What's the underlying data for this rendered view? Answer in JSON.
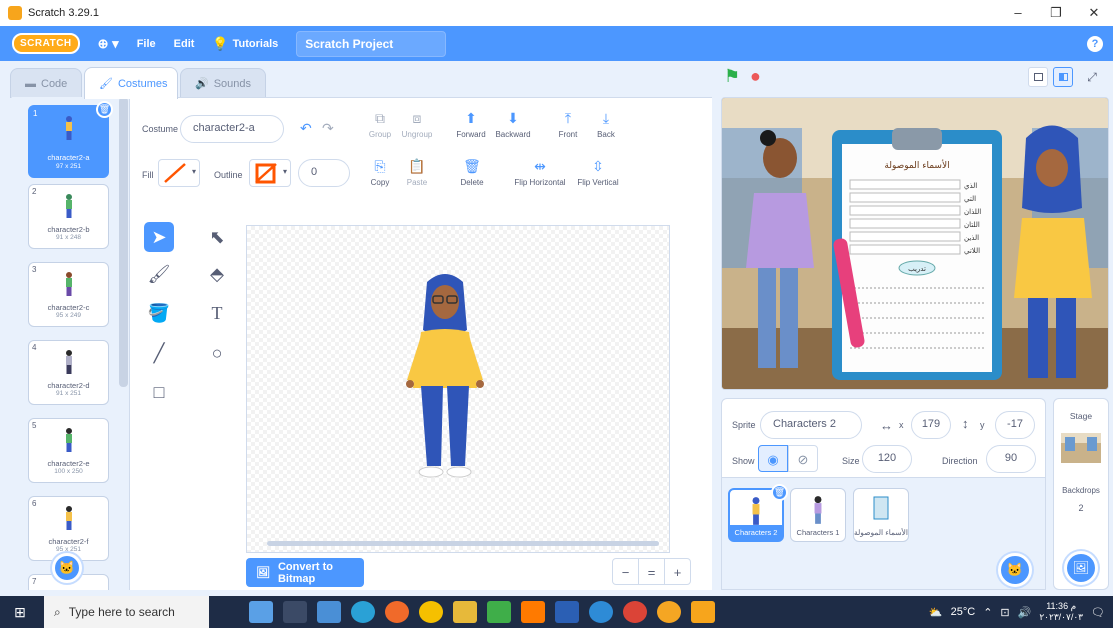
{
  "window": {
    "title": "Scratch 3.29.1",
    "controls": [
      "–",
      "❐",
      "✕"
    ]
  },
  "menubar": {
    "logo": "SCRATCH",
    "globe": "⊕ ▾",
    "file": "File",
    "edit": "Edit",
    "tutorials": "Tutorials",
    "project_title": "Scratch Project",
    "help": "?"
  },
  "tabs": {
    "code": "Code",
    "costumes": "Costumes",
    "sounds": "Sounds"
  },
  "costumes": [
    {
      "num": "1",
      "name": "character2-a",
      "size": "97 x 251"
    },
    {
      "num": "2",
      "name": "character2-b",
      "size": "91 x 248"
    },
    {
      "num": "3",
      "name": "character2-c",
      "size": "95 x 249"
    },
    {
      "num": "4",
      "name": "character2-d",
      "size": "91 x 251"
    },
    {
      "num": "5",
      "name": "character2-e",
      "size": "100 x 250"
    },
    {
      "num": "6",
      "name": "character2-f",
      "size": "95 x 251"
    },
    {
      "num": "7",
      "name": "",
      "size": ""
    }
  ],
  "editor": {
    "costume_label": "Costume",
    "costume_name": "character2-a",
    "fill_label": "Fill",
    "outline_label": "Outline",
    "outline_width": "0",
    "group": "Group",
    "ungroup": "Ungroup",
    "forward": "Forward",
    "backward": "Backward",
    "front": "Front",
    "back": "Back",
    "copy": "Copy",
    "paste": "Paste",
    "delete": "Delete",
    "flip_h": "Flip Horizontal",
    "flip_v": "Flip Vertical",
    "convert": "Convert to Bitmap",
    "zoom_out": "−",
    "zoom_reset": "=",
    "zoom_in": "+"
  },
  "stage_controls": {
    "green_flag": "⚑",
    "stop": "●"
  },
  "sprite_info": {
    "sprite_label": "Sprite",
    "sprite_name": "Characters 2",
    "x_label": "x",
    "x": "179",
    "y_label": "y",
    "y": "-17",
    "show_label": "Show",
    "size_label": "Size",
    "size": "120",
    "direction_label": "Direction",
    "direction": "90"
  },
  "sprites": [
    {
      "name": "Characters 2"
    },
    {
      "name": "Characters 1"
    },
    {
      "name": "الأسماء الموصولة"
    }
  ],
  "stage_panel": {
    "title": "Stage",
    "backdrops_label": "Backdrops",
    "backdrops": "2"
  },
  "worksheet": {
    "title": "الأسماء الموصولة",
    "rows": [
      "الذي",
      "التي",
      "اللذان",
      "اللتان",
      "الذين",
      "اللاتي"
    ],
    "example": "تدريب"
  },
  "taskbar": {
    "search": "Type here to search",
    "weather": "25°C",
    "time": "11:36 م",
    "date": "٢٠٢٣/٠٧/٠٣"
  },
  "colors": {
    "accent": "#4c97ff",
    "menubar": "#4c97ff",
    "costume_fill": "#ff5500",
    "outline": "#ff5500"
  }
}
